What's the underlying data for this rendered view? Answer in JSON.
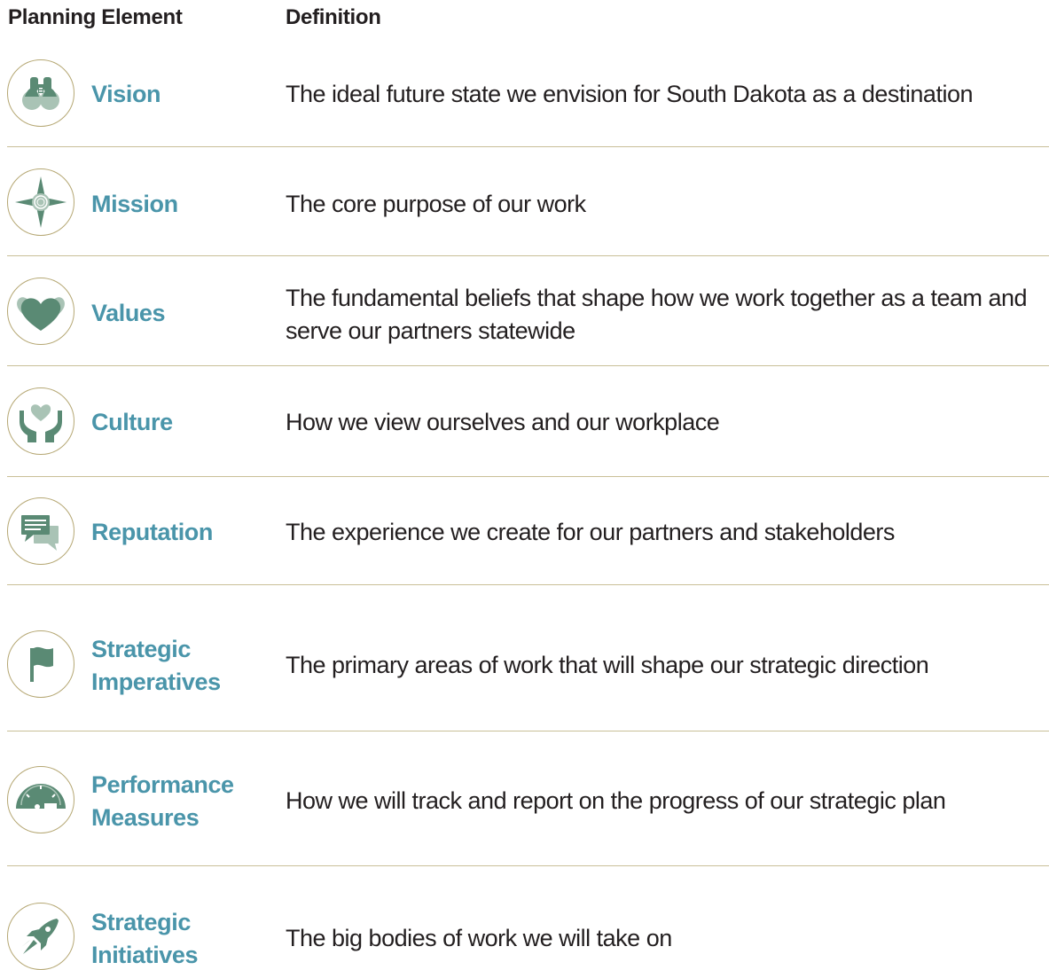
{
  "header": {
    "planning_element": "Planning Element",
    "definition": "Definition"
  },
  "colors": {
    "label": "#4a95aa",
    "icon_green": "#5a8a74",
    "icon_light": "#a9c3b5",
    "circle_border": "#b5a773",
    "divider": "#c9bf98",
    "text": "#231f20"
  },
  "rows": [
    {
      "icon": "binoculars-icon",
      "label": "Vision",
      "definition": "The ideal future state we envision for South Dakota as a destination"
    },
    {
      "icon": "compass-icon",
      "label": "Mission",
      "definition": "The core purpose of our work"
    },
    {
      "icon": "heart-icon",
      "label": "Values",
      "definition": "The fundamental beliefs that shape how we work together as a team and serve our partners statewide"
    },
    {
      "icon": "hands-heart-icon",
      "label": "Culture",
      "definition": "How we view ourselves and our workplace"
    },
    {
      "icon": "speech-bubbles-icon",
      "label": "Reputation",
      "definition": "The experience we create for our partners and stakeholders"
    },
    {
      "icon": "flag-icon",
      "label": "Strategic\nImperatives",
      "definition": "The primary areas of work that will shape our strategic direction"
    },
    {
      "icon": "gauge-icon",
      "label": "Performance\nMeasures",
      "definition": "How we will track and report on the progress of our strategic plan"
    },
    {
      "icon": "rocket-icon",
      "label": "Strategic\nInitiatives",
      "definition": "The big bodies of work we will take on"
    }
  ]
}
